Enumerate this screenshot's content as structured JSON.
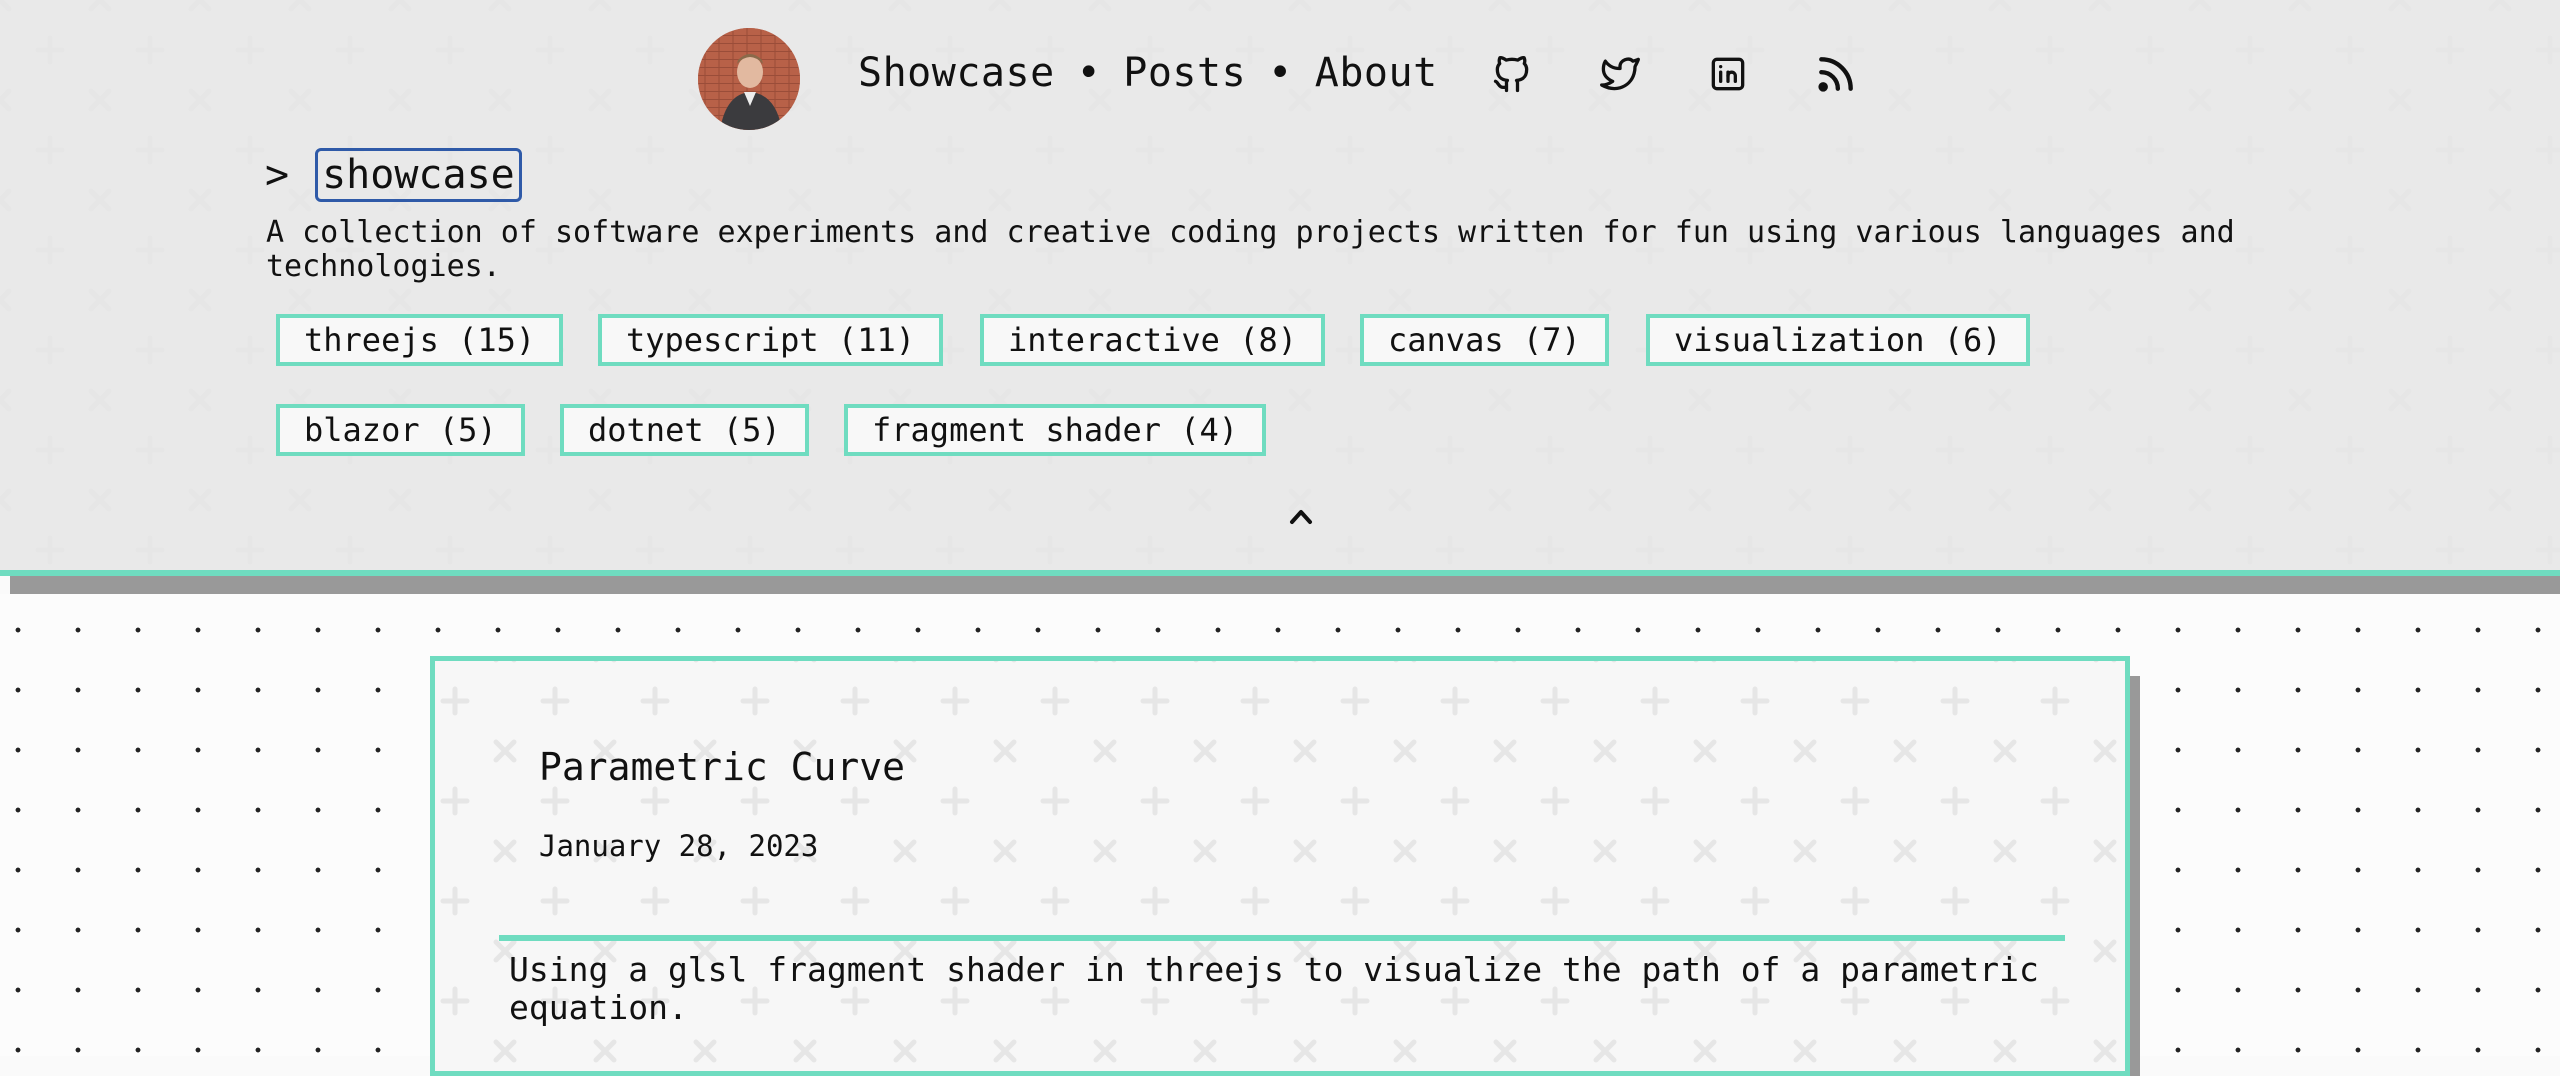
{
  "nav": {
    "links": [
      "Showcase",
      "Posts",
      "About"
    ],
    "separator": "•",
    "social_icons": [
      "github-icon",
      "twitter-icon",
      "linkedin-icon",
      "rss-icon"
    ]
  },
  "page": {
    "prompt": ">",
    "title": "showcase",
    "description": "A collection of software experiments and creative coding projects written for fun using various languages and technologies."
  },
  "tags": [
    "threejs (15)",
    "typescript (11)",
    "interactive (8)",
    "canvas (7)",
    "visualization (6)",
    "blazor (5)",
    "dotnet (5)",
    "fragment shader (4)"
  ],
  "toggle_icon": "chevron-up-icon",
  "post": {
    "title": "Parametric Curve",
    "date": "January 28, 2023",
    "description": "Using a glsl fragment shader in threejs to visualize the path of a parametric equation."
  },
  "colors": {
    "accent": "#6fdcc0",
    "focus": "#2f5aa8",
    "shadow": "#999999",
    "text": "#111111"
  }
}
